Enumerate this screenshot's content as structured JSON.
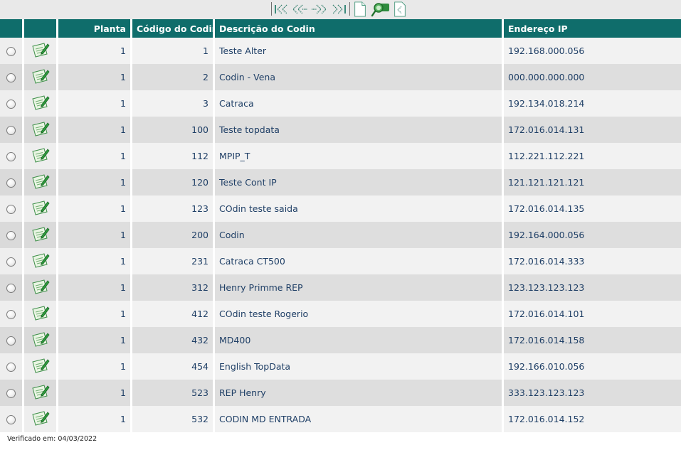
{
  "toolbar": {
    "buttons": [
      {
        "name": "first-page-button",
        "icon": "first-page-icon"
      },
      {
        "name": "previous-page-button",
        "icon": "previous-page-icon"
      },
      {
        "name": "next-page-button",
        "icon": "next-page-icon"
      },
      {
        "name": "last-page-button",
        "icon": "last-page-icon"
      },
      {
        "name": "new-record-button",
        "icon": "new-document-icon"
      },
      {
        "name": "search-button",
        "icon": "search-icon"
      },
      {
        "name": "export-button",
        "icon": "export-icon"
      }
    ]
  },
  "table": {
    "headers": {
      "select": "",
      "edit": "",
      "planta": "Planta",
      "codigo": "Código do Codin",
      "descricao": "Descrição do Codin",
      "ip": "Endereço IP"
    },
    "rows": [
      {
        "planta": "1",
        "codigo": "1",
        "descricao": "Teste Alter",
        "ip": "192.168.000.056"
      },
      {
        "planta": "1",
        "codigo": "2",
        "descricao": "Codin - Vena",
        "ip": "000.000.000.000"
      },
      {
        "planta": "1",
        "codigo": "3",
        "descricao": "Catraca",
        "ip": "192.134.018.214"
      },
      {
        "planta": "1",
        "codigo": "100",
        "descricao": "Teste topdata",
        "ip": "172.016.014.131"
      },
      {
        "planta": "1",
        "codigo": "112",
        "descricao": "MPIP_T",
        "ip": "112.221.112.221"
      },
      {
        "planta": "1",
        "codigo": "120",
        "descricao": "Teste Cont IP",
        "ip": "121.121.121.121"
      },
      {
        "planta": "1",
        "codigo": "123",
        "descricao": "COdin teste saida",
        "ip": "172.016.014.135"
      },
      {
        "planta": "1",
        "codigo": "200",
        "descricao": "Codin",
        "ip": "192.164.000.056"
      },
      {
        "planta": "1",
        "codigo": "231",
        "descricao": "Catraca CT500",
        "ip": "172.016.014.333"
      },
      {
        "planta": "1",
        "codigo": "312",
        "descricao": "Henry Primme REP",
        "ip": "123.123.123.123"
      },
      {
        "planta": "1",
        "codigo": "412",
        "descricao": "COdin teste Rogerio",
        "ip": "172.016.014.101"
      },
      {
        "planta": "1",
        "codigo": "432",
        "descricao": "MD400",
        "ip": "172.016.014.158"
      },
      {
        "planta": "1",
        "codigo": "454",
        "descricao": "English TopData",
        "ip": "192.166.010.056"
      },
      {
        "planta": "1",
        "codigo": "523",
        "descricao": "REP Henry",
        "ip": "333.123.123.123"
      },
      {
        "planta": "1",
        "codigo": "532",
        "descricao": "CODIN MD ENTRADA",
        "ip": "172.016.014.152"
      }
    ]
  },
  "footer": {
    "text": "Verificado em: 04/03/2022"
  },
  "colors": {
    "header_bg": "#0f6d6b",
    "row_odd": "#f2f2f2",
    "row_even": "#dedede",
    "text": "#1f3f66"
  }
}
